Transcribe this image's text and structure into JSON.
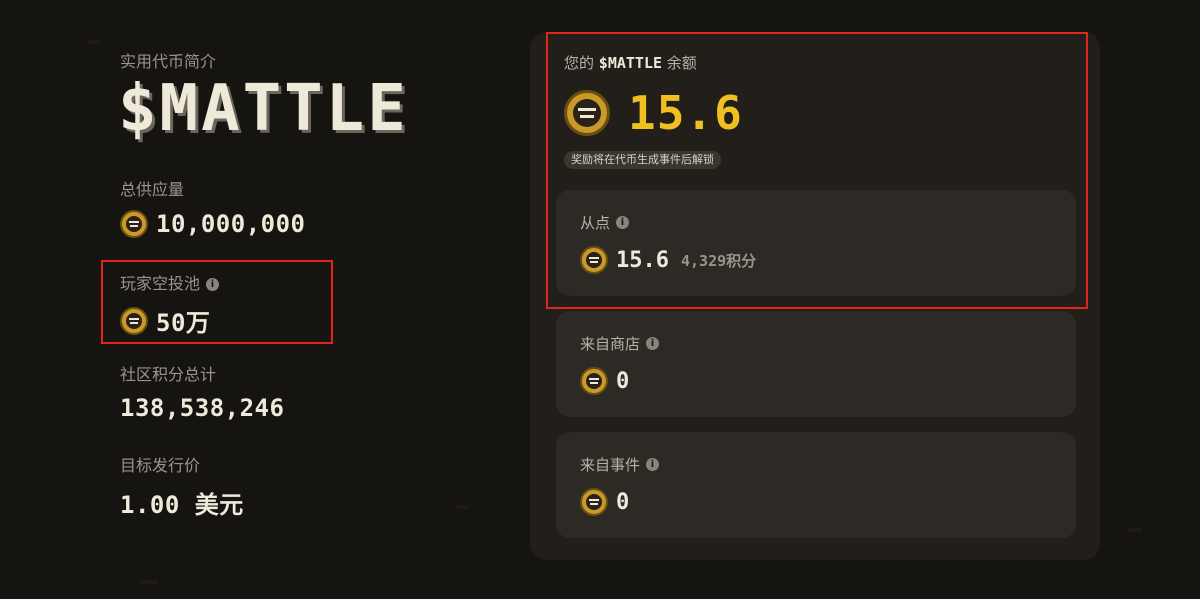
{
  "intro": {
    "eyebrow": "实用代币简介",
    "brand": "$MATTLE"
  },
  "stats": [
    {
      "label": "总供应量",
      "value": "10,000,000",
      "icon": "coin-icon"
    },
    {
      "label": "玩家空投池",
      "value": "50万",
      "icon": "coin-icon",
      "info": "i"
    },
    {
      "label": "社区积分总计",
      "value": "138,538,246"
    },
    {
      "label": "目标发行价",
      "value": "1.00 美元"
    }
  ],
  "balance": {
    "title_prefix": "您的",
    "title_token": "$MATTLE",
    "title_suffix": "余额",
    "amount": "15.6",
    "unlock_note": "奖励将在代币生成事件后解锁"
  },
  "sources": [
    {
      "label": "从点",
      "value": "15.6",
      "sub": "4,329积分",
      "info": "i"
    },
    {
      "label": "来自商店",
      "value": "0",
      "info": "i"
    },
    {
      "label": "来自事件",
      "value": "0",
      "info": "i"
    }
  ],
  "colors": {
    "background": "#161411",
    "accent_gold": "#f0c020",
    "highlight_red": "#e0251a",
    "panel": "#221f1b",
    "card": "#2d2a25"
  }
}
